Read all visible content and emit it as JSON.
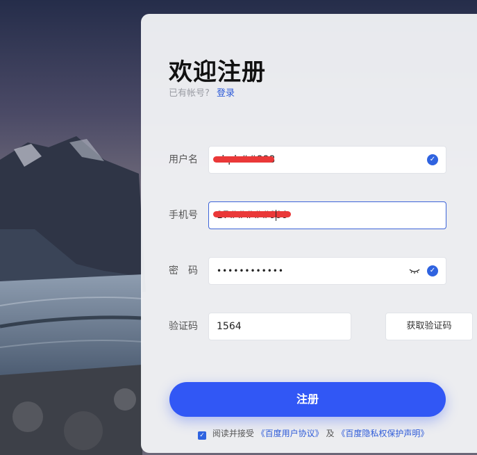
{
  "page": {
    "title": "欢迎注册",
    "has_account_text": "已有帐号?",
    "login_link": "登录"
  },
  "form": {
    "username": {
      "label": "用户名",
      "value": "zhpb##888"
    },
    "phone": {
      "label": "手机号",
      "value": "17#####999"
    },
    "password": {
      "label": "密　码",
      "value": "••••••••••••"
    },
    "captcha": {
      "label": "验证码",
      "value": "1564",
      "button": "获取验证码"
    }
  },
  "submit_label": "注册",
  "agreement": {
    "prefix": "阅读并接受",
    "link1": "《百度用户协议》",
    "and": "及",
    "link2": "《百度隐私权保护声明》"
  },
  "colors": {
    "accent": "#3157f5",
    "link": "#2e5bd8",
    "redaction": "#ea3838"
  },
  "icons": {
    "valid": "check-circle-icon",
    "password_toggle": "eye-closed-icon"
  }
}
